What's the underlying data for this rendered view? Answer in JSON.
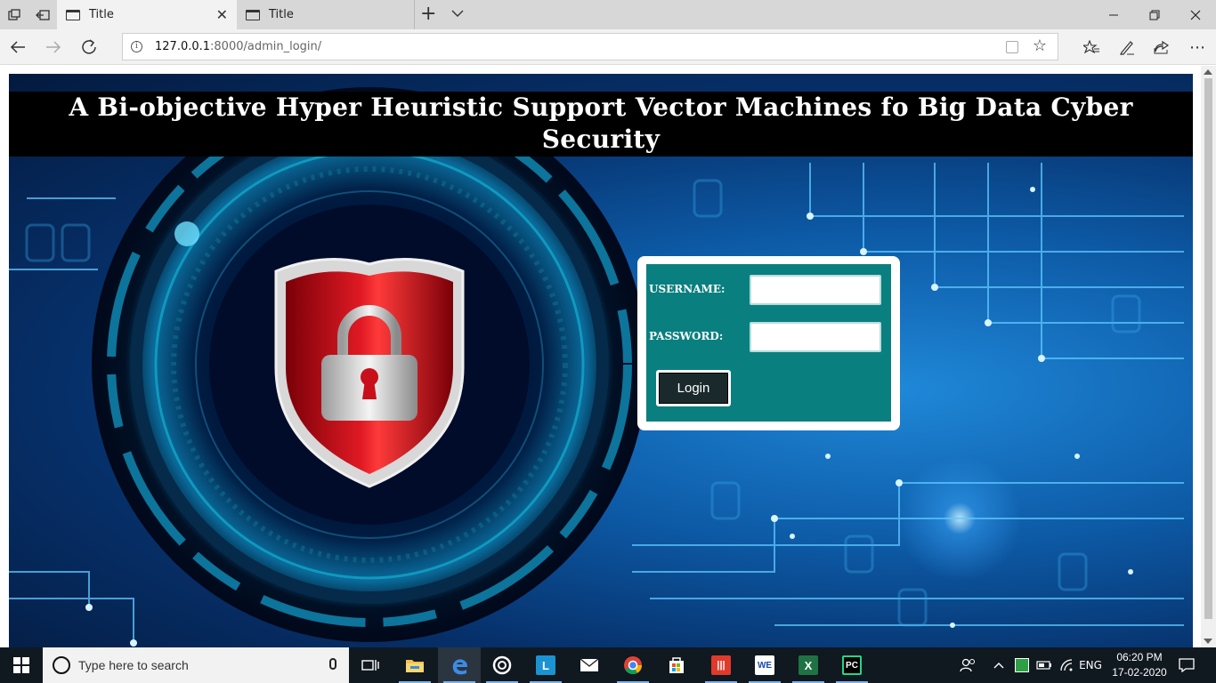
{
  "browser": {
    "tabs": [
      {
        "title": "Title",
        "active": true
      },
      {
        "title": "Title",
        "active": false
      }
    ],
    "url": {
      "host": "127.0.0.1",
      "path": ":8000/admin_login/"
    }
  },
  "page": {
    "title": "A Bi-objective Hyper Heuristic Support Vector Machines fo Big Data Cyber Security",
    "login": {
      "username_label": "USERNAME:",
      "password_label": "PASSWORD:",
      "username_value": "",
      "password_value": "",
      "button_label": "Login"
    }
  },
  "hero": {
    "icons": [
      "shield-icon",
      "padlock-icon",
      "keyhole-icon"
    ],
    "colors": {
      "shield_red": "#d0121a",
      "panel_teal": "#0a7f7f",
      "background_blue": "#0d5aa6"
    }
  },
  "taskbar": {
    "search_placeholder": "Type here to search",
    "apps": [
      "task-view-icon",
      "file-explorer-icon",
      "edge-icon",
      "app-ring-icon",
      "app-l-icon",
      "mail-icon",
      "chrome-icon",
      "store-icon",
      "app-bars-icon",
      "app-we-icon",
      "excel-icon",
      "pycharm-icon"
    ],
    "app_labels": {
      "l": "L",
      "we": "WE",
      "excel": "X",
      "pycharm": "PC"
    },
    "language": "ENG",
    "time": "06:20 PM",
    "date": "17-02-2020"
  }
}
